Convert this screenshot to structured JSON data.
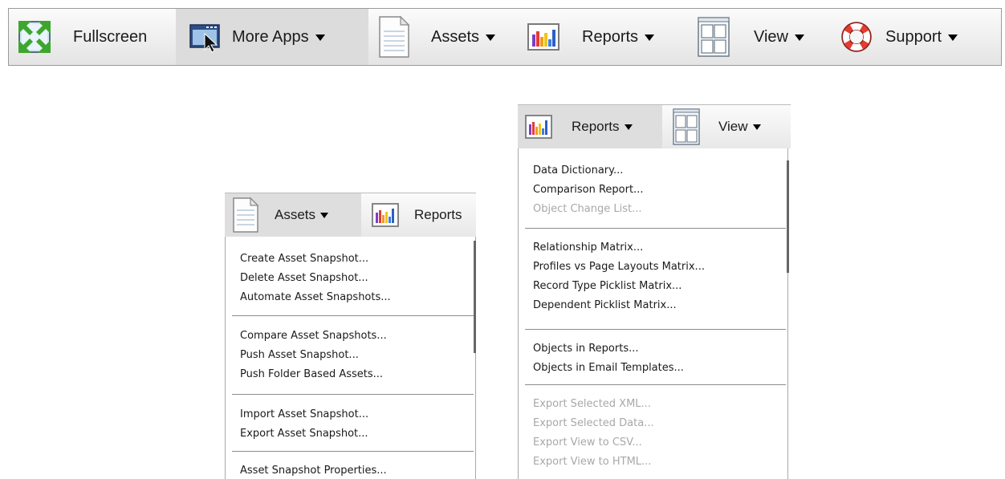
{
  "toolbar": {
    "fullscreen": "Fullscreen",
    "more_apps": "More Apps",
    "assets": "Assets",
    "reports": "Reports",
    "view": "View",
    "support": "Support"
  },
  "assets_bar": {
    "assets": "Assets",
    "reports_partial": "Reports"
  },
  "assets_menu": {
    "items": [
      "Create Asset Snapshot...",
      "Delete Asset Snapshot...",
      "Automate Asset Snapshots...",
      "Compare Asset Snapshots...",
      "Push Asset Snapshot...",
      "Push Folder Based Assets...",
      "Import Asset Snapshot...",
      "Export Asset Snapshot...",
      "Asset Snapshot Properties..."
    ]
  },
  "reports_bar": {
    "reports": "Reports",
    "view": "View"
  },
  "reports_menu": {
    "items": [
      "Data Dictionary...",
      "Comparison Report...",
      "Object Change List...",
      "Relationship Matrix...",
      "Profiles vs Page Layouts Matrix...",
      "Record Type Picklist Matrix...",
      "Dependent Picklist Matrix...",
      "Objects in Reports...",
      "Objects in Email Templates...",
      "Export Selected XML...",
      "Export Selected Data...",
      "Export View to CSV...",
      "Export View to HTML..."
    ],
    "disabled": [
      2,
      9,
      10,
      11,
      12
    ]
  },
  "colors": {
    "toolbar_border": "#9a9a9a",
    "menu_text": "#1a1a1a",
    "menu_disabled": "#a8a8a8",
    "active_button": "#dcdcdc"
  }
}
